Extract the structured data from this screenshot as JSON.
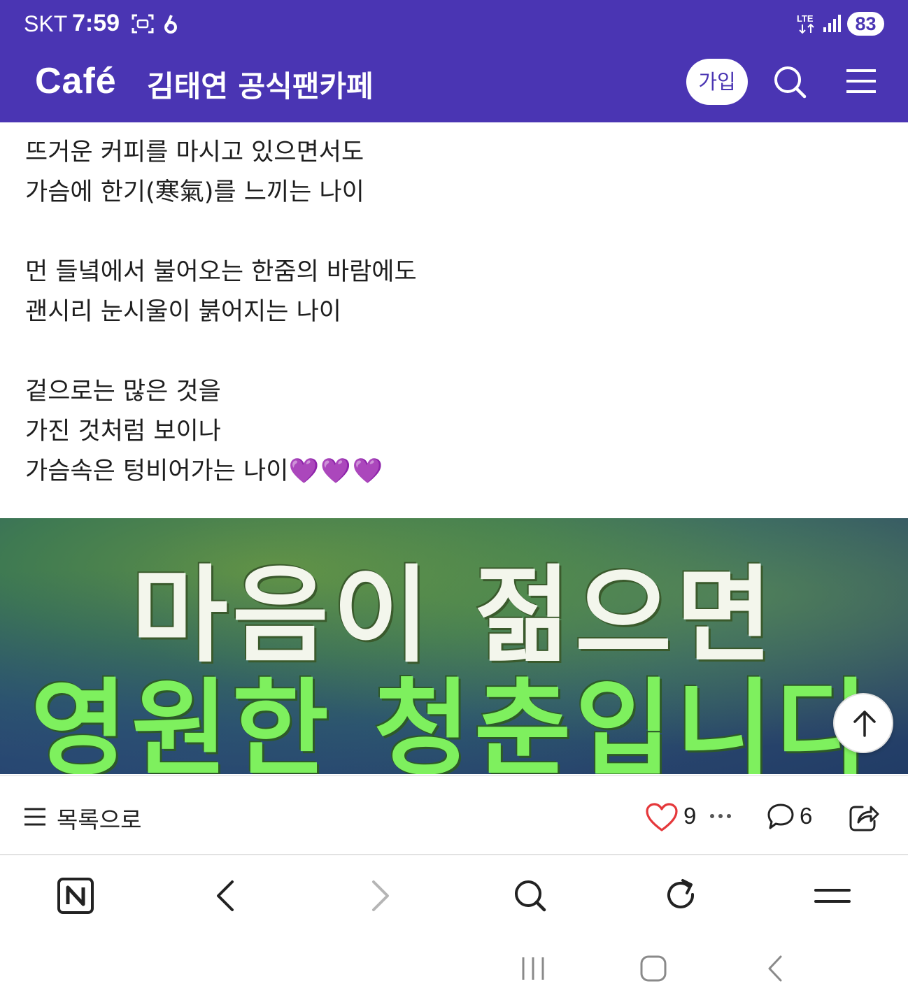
{
  "status_bar": {
    "carrier": "SKT",
    "time": "7:59",
    "network": "LTE",
    "battery": "83"
  },
  "header": {
    "brand": "Café",
    "cafe_name": "김태연 공식팬카페",
    "join_label": "가입",
    "icons": [
      "search-icon",
      "menu-icon"
    ],
    "background_color": "#4a35b3"
  },
  "post": {
    "lines": [
      "뜨거운 커피를 마시고 있으면서도",
      "가슴에 한기(寒氣)를 느끼는 나이",
      "",
      "먼 들녘에서 불어오는 한줌의 바람에도",
      "괜시리 눈시울이 붉어지는 나이",
      "",
      "겉으로는 많은 것을",
      "가진 것처럼 보이나",
      "가슴속은 텅비어가는 나이"
    ],
    "trailing_emoji": "💜💜💜"
  },
  "banner": {
    "line1": "마음이 젊으면",
    "line2": "영원한 청춘입니다"
  },
  "actions": {
    "list_label": "목록으로",
    "like_count": "9",
    "comment_count": "6",
    "like_color": "#e5383b"
  },
  "browser_bar": {
    "icons": [
      "naver-icon",
      "back-arrow-icon",
      "forward-arrow-icon",
      "search-icon",
      "refresh-icon",
      "menu-icon"
    ]
  },
  "system_nav": {
    "icons": [
      "recent-apps-icon",
      "home-icon",
      "back-icon"
    ]
  }
}
